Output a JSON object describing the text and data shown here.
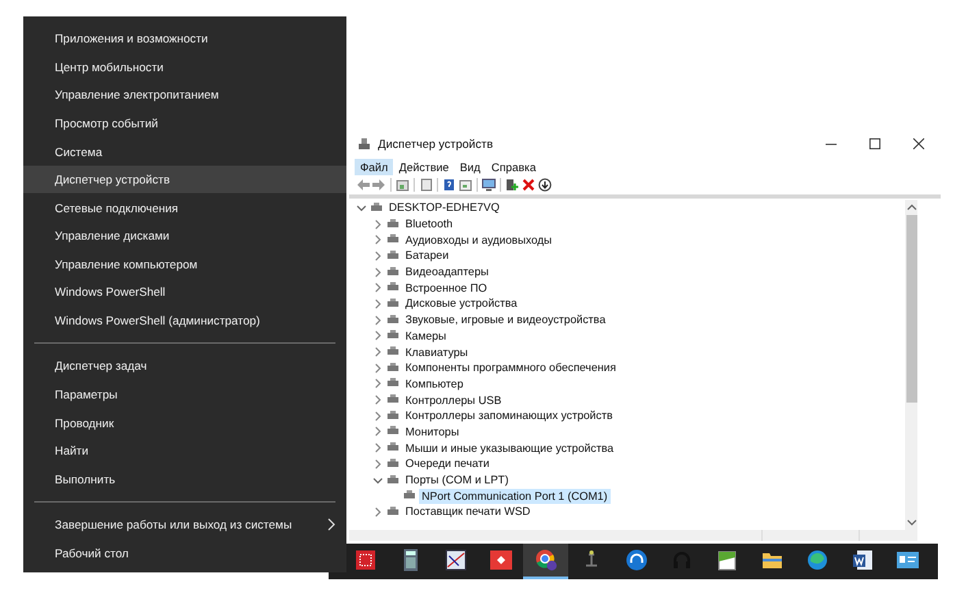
{
  "context_menu": {
    "groups": [
      {
        "items": [
          {
            "label": "Приложения и возможности",
            "selected": false
          },
          {
            "label": "Центр мобильности",
            "selected": false
          },
          {
            "label": "Управление электропитанием",
            "selected": false
          },
          {
            "label": "Просмотр событий",
            "selected": false
          },
          {
            "label": "Система",
            "selected": false
          },
          {
            "label": "Диспетчер устройств",
            "selected": true
          },
          {
            "label": "Сетевые подключения",
            "selected": false
          },
          {
            "label": "Управление дисками",
            "selected": false
          },
          {
            "label": "Управление компьютером",
            "selected": false
          },
          {
            "label": "Windows PowerShell",
            "selected": false
          },
          {
            "label": "Windows PowerShell (администратор)",
            "selected": false
          }
        ]
      },
      {
        "items": [
          {
            "label": "Диспетчер задач",
            "selected": false
          },
          {
            "label": "Параметры",
            "selected": false
          },
          {
            "label": "Проводник",
            "selected": false
          },
          {
            "label": "Найти",
            "selected": false
          },
          {
            "label": "Выполнить",
            "selected": false
          }
        ]
      },
      {
        "items": [
          {
            "label": "Завершение работы или выход из системы",
            "selected": false,
            "kind": "submenu"
          },
          {
            "label": "Рабочий стол",
            "selected": false,
            "kind": "plain"
          }
        ]
      }
    ]
  },
  "window": {
    "title": "Диспетчер устройств",
    "menu": [
      {
        "label": "Файл",
        "selected": true
      },
      {
        "label": "Действие",
        "selected": false
      },
      {
        "label": "Вид",
        "selected": false
      },
      {
        "label": "Справка",
        "selected": false
      }
    ],
    "tree": [
      {
        "label": "DESKTOP-EDHE7VQ",
        "expanded": true,
        "selected": false,
        "children": [
          {
            "label": "Bluetooth",
            "expanded": false,
            "selected": false
          },
          {
            "label": "Аудиовходы и аудиовыходы",
            "expanded": false,
            "selected": false
          },
          {
            "label": "Батареи",
            "expanded": false,
            "selected": false
          },
          {
            "label": "Видеоадаптеры",
            "expanded": false,
            "selected": false
          },
          {
            "label": "Встроенное ПО",
            "expanded": false,
            "selected": false
          },
          {
            "label": "Дисковые устройства",
            "expanded": false,
            "selected": false
          },
          {
            "label": "Звуковые, игровые и видеоустройства",
            "expanded": false,
            "selected": false
          },
          {
            "label": "Камеры",
            "expanded": false,
            "selected": false
          },
          {
            "label": "Клавиатуры",
            "expanded": false,
            "selected": false
          },
          {
            "label": "Компоненты программного обеспечения",
            "expanded": false,
            "selected": false
          },
          {
            "label": "Компьютер",
            "expanded": false,
            "selected": false
          },
          {
            "label": "Контроллеры USB",
            "expanded": false,
            "selected": false
          },
          {
            "label": "Контроллеры запоминающих устройств",
            "expanded": false,
            "selected": false
          },
          {
            "label": "Мониторы",
            "expanded": false,
            "selected": false
          },
          {
            "label": "Мыши и иные указывающие устройства",
            "expanded": false,
            "selected": false
          },
          {
            "label": "Очереди печати",
            "expanded": false,
            "selected": false
          },
          {
            "label": "Порты (COM и LPT)",
            "expanded": true,
            "selected": false,
            "children": [
              {
                "label": "NPort Communication Port 1 (COM1)",
                "selected": true
              }
            ]
          },
          {
            "label": "Поставщик печати WSD",
            "expanded": false,
            "selected": false
          }
        ]
      }
    ]
  },
  "taskbar": {
    "apps": [
      {
        "selected": false
      },
      {
        "selected": false
      },
      {
        "selected": false
      },
      {
        "selected": false
      },
      {
        "selected": true
      },
      {
        "selected": false
      },
      {
        "selected": false
      },
      {
        "selected": false
      },
      {
        "selected": false
      },
      {
        "selected": false
      },
      {
        "selected": false
      },
      {
        "selected": false
      },
      {
        "selected": false
      }
    ]
  }
}
